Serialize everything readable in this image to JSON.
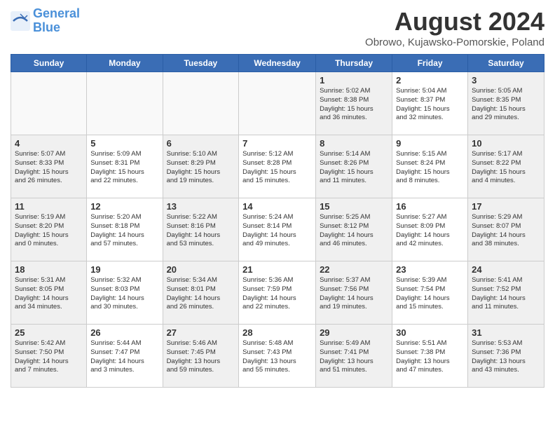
{
  "header": {
    "logo_line1": "General",
    "logo_line2": "Blue",
    "month_title": "August 2024",
    "location": "Obrowo, Kujawsko-Pomorskie, Poland"
  },
  "days_of_week": [
    "Sunday",
    "Monday",
    "Tuesday",
    "Wednesday",
    "Thursday",
    "Friday",
    "Saturday"
  ],
  "weeks": [
    [
      {
        "day": "",
        "info": ""
      },
      {
        "day": "",
        "info": ""
      },
      {
        "day": "",
        "info": ""
      },
      {
        "day": "",
        "info": ""
      },
      {
        "day": "1",
        "info": "Sunrise: 5:02 AM\nSunset: 8:38 PM\nDaylight: 15 hours\nand 36 minutes."
      },
      {
        "day": "2",
        "info": "Sunrise: 5:04 AM\nSunset: 8:37 PM\nDaylight: 15 hours\nand 32 minutes."
      },
      {
        "day": "3",
        "info": "Sunrise: 5:05 AM\nSunset: 8:35 PM\nDaylight: 15 hours\nand 29 minutes."
      }
    ],
    [
      {
        "day": "4",
        "info": "Sunrise: 5:07 AM\nSunset: 8:33 PM\nDaylight: 15 hours\nand 26 minutes."
      },
      {
        "day": "5",
        "info": "Sunrise: 5:09 AM\nSunset: 8:31 PM\nDaylight: 15 hours\nand 22 minutes."
      },
      {
        "day": "6",
        "info": "Sunrise: 5:10 AM\nSunset: 8:29 PM\nDaylight: 15 hours\nand 19 minutes."
      },
      {
        "day": "7",
        "info": "Sunrise: 5:12 AM\nSunset: 8:28 PM\nDaylight: 15 hours\nand 15 minutes."
      },
      {
        "day": "8",
        "info": "Sunrise: 5:14 AM\nSunset: 8:26 PM\nDaylight: 15 hours\nand 11 minutes."
      },
      {
        "day": "9",
        "info": "Sunrise: 5:15 AM\nSunset: 8:24 PM\nDaylight: 15 hours\nand 8 minutes."
      },
      {
        "day": "10",
        "info": "Sunrise: 5:17 AM\nSunset: 8:22 PM\nDaylight: 15 hours\nand 4 minutes."
      }
    ],
    [
      {
        "day": "11",
        "info": "Sunrise: 5:19 AM\nSunset: 8:20 PM\nDaylight: 15 hours\nand 0 minutes."
      },
      {
        "day": "12",
        "info": "Sunrise: 5:20 AM\nSunset: 8:18 PM\nDaylight: 14 hours\nand 57 minutes."
      },
      {
        "day": "13",
        "info": "Sunrise: 5:22 AM\nSunset: 8:16 PM\nDaylight: 14 hours\nand 53 minutes."
      },
      {
        "day": "14",
        "info": "Sunrise: 5:24 AM\nSunset: 8:14 PM\nDaylight: 14 hours\nand 49 minutes."
      },
      {
        "day": "15",
        "info": "Sunrise: 5:25 AM\nSunset: 8:12 PM\nDaylight: 14 hours\nand 46 minutes."
      },
      {
        "day": "16",
        "info": "Sunrise: 5:27 AM\nSunset: 8:09 PM\nDaylight: 14 hours\nand 42 minutes."
      },
      {
        "day": "17",
        "info": "Sunrise: 5:29 AM\nSunset: 8:07 PM\nDaylight: 14 hours\nand 38 minutes."
      }
    ],
    [
      {
        "day": "18",
        "info": "Sunrise: 5:31 AM\nSunset: 8:05 PM\nDaylight: 14 hours\nand 34 minutes."
      },
      {
        "day": "19",
        "info": "Sunrise: 5:32 AM\nSunset: 8:03 PM\nDaylight: 14 hours\nand 30 minutes."
      },
      {
        "day": "20",
        "info": "Sunrise: 5:34 AM\nSunset: 8:01 PM\nDaylight: 14 hours\nand 26 minutes."
      },
      {
        "day": "21",
        "info": "Sunrise: 5:36 AM\nSunset: 7:59 PM\nDaylight: 14 hours\nand 22 minutes."
      },
      {
        "day": "22",
        "info": "Sunrise: 5:37 AM\nSunset: 7:56 PM\nDaylight: 14 hours\nand 19 minutes."
      },
      {
        "day": "23",
        "info": "Sunrise: 5:39 AM\nSunset: 7:54 PM\nDaylight: 14 hours\nand 15 minutes."
      },
      {
        "day": "24",
        "info": "Sunrise: 5:41 AM\nSunset: 7:52 PM\nDaylight: 14 hours\nand 11 minutes."
      }
    ],
    [
      {
        "day": "25",
        "info": "Sunrise: 5:42 AM\nSunset: 7:50 PM\nDaylight: 14 hours\nand 7 minutes."
      },
      {
        "day": "26",
        "info": "Sunrise: 5:44 AM\nSunset: 7:47 PM\nDaylight: 14 hours\nand 3 minutes."
      },
      {
        "day": "27",
        "info": "Sunrise: 5:46 AM\nSunset: 7:45 PM\nDaylight: 13 hours\nand 59 minutes."
      },
      {
        "day": "28",
        "info": "Sunrise: 5:48 AM\nSunset: 7:43 PM\nDaylight: 13 hours\nand 55 minutes."
      },
      {
        "day": "29",
        "info": "Sunrise: 5:49 AM\nSunset: 7:41 PM\nDaylight: 13 hours\nand 51 minutes."
      },
      {
        "day": "30",
        "info": "Sunrise: 5:51 AM\nSunset: 7:38 PM\nDaylight: 13 hours\nand 47 minutes."
      },
      {
        "day": "31",
        "info": "Sunrise: 5:53 AM\nSunset: 7:36 PM\nDaylight: 13 hours\nand 43 minutes."
      }
    ]
  ]
}
